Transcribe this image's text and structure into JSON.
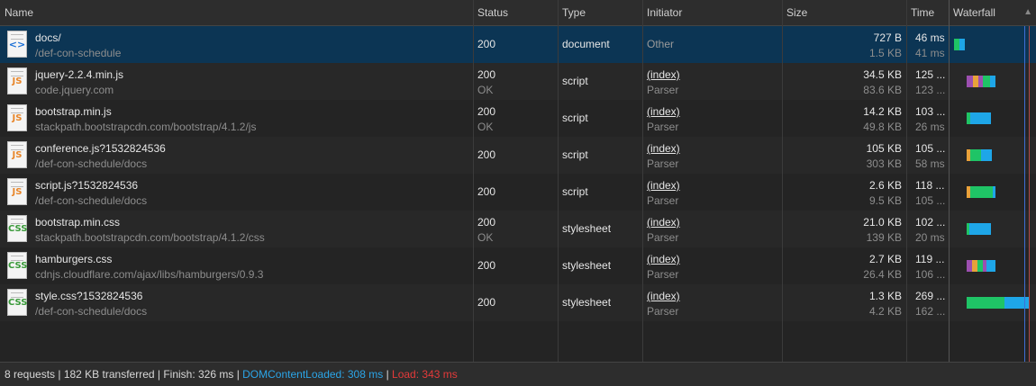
{
  "columns": {
    "name": "Name",
    "status": "Status",
    "type": "Type",
    "initiator": "Initiator",
    "size": "Size",
    "time": "Time",
    "waterfall": "Waterfall"
  },
  "sort_indicator": "▲",
  "requests": [
    {
      "icon": "doc",
      "icon_text": "<>",
      "name": "docs/",
      "path": "/def-con-schedule",
      "status": "200",
      "status_text": "",
      "type": "document",
      "initiator": "Other",
      "initiator_link": false,
      "initiator_sub": "",
      "size": "727 B",
      "resource_size": "1.5 KB",
      "time": "46 ms",
      "latency": "41 ms",
      "selected": true
    },
    {
      "icon": "js",
      "icon_text": "JS",
      "name": "jquery-2.2.4.min.js",
      "path": "code.jquery.com",
      "status": "200",
      "status_text": "OK",
      "type": "script",
      "initiator": "(index)",
      "initiator_link": true,
      "initiator_sub": "Parser",
      "size": "34.5 KB",
      "resource_size": "83.6 KB",
      "time": "125 ...",
      "latency": "123 ..."
    },
    {
      "icon": "js",
      "icon_text": "JS",
      "name": "bootstrap.min.js",
      "path": "stackpath.bootstrapcdn.com/bootstrap/4.1.2/js",
      "status": "200",
      "status_text": "OK",
      "type": "script",
      "initiator": "(index)",
      "initiator_link": true,
      "initiator_sub": "Parser",
      "size": "14.2 KB",
      "resource_size": "49.8 KB",
      "time": "103 ...",
      "latency": "26 ms"
    },
    {
      "icon": "js",
      "icon_text": "JS",
      "name": "conference.js?1532824536",
      "path": "/def-con-schedule/docs",
      "status": "200",
      "status_text": "",
      "type": "script",
      "initiator": "(index)",
      "initiator_link": true,
      "initiator_sub": "Parser",
      "size": "105 KB",
      "resource_size": "303 KB",
      "time": "105 ...",
      "latency": "58 ms"
    },
    {
      "icon": "js",
      "icon_text": "JS",
      "name": "script.js?1532824536",
      "path": "/def-con-schedule/docs",
      "status": "200",
      "status_text": "",
      "type": "script",
      "initiator": "(index)",
      "initiator_link": true,
      "initiator_sub": "Parser",
      "size": "2.6 KB",
      "resource_size": "9.5 KB",
      "time": "118 ...",
      "latency": "105 ..."
    },
    {
      "icon": "css",
      "icon_text": "CSS",
      "name": "bootstrap.min.css",
      "path": "stackpath.bootstrapcdn.com/bootstrap/4.1.2/css",
      "status": "200",
      "status_text": "OK",
      "type": "stylesheet",
      "initiator": "(index)",
      "initiator_link": true,
      "initiator_sub": "Parser",
      "size": "21.0 KB",
      "resource_size": "139 KB",
      "time": "102 ...",
      "latency": "20 ms"
    },
    {
      "icon": "css",
      "icon_text": "CSS",
      "name": "hamburgers.css",
      "path": "cdnjs.cloudflare.com/ajax/libs/hamburgers/0.9.3",
      "status": "200",
      "status_text": "",
      "type": "stylesheet",
      "initiator": "(index)",
      "initiator_link": true,
      "initiator_sub": "Parser",
      "size": "2.7 KB",
      "resource_size": "26.4 KB",
      "time": "119 ...",
      "latency": "106 ..."
    },
    {
      "icon": "css",
      "icon_text": "CSS",
      "name": "style.css?1532824536",
      "path": "/def-con-schedule/docs",
      "status": "200",
      "status_text": "",
      "type": "stylesheet",
      "initiator": "(index)",
      "initiator_link": true,
      "initiator_sub": "Parser",
      "size": "1.3 KB",
      "resource_size": "4.2 KB",
      "time": "269 ...",
      "latency": "162 ..."
    }
  ],
  "footer": {
    "summary": "8 requests | 182 KB transferred | Finish: 326 ms | ",
    "dom_content_loaded": "DOMContentLoaded: 308 ms",
    "separator": " | ",
    "load": "Load: 343 ms"
  },
  "colors": {
    "dom_content_loaded": "#2ba5e8",
    "load": "#e43a3a",
    "waiting": "#1fc466",
    "download": "#1ea6e8",
    "dns": "#9c4fb0",
    "connect": "#e8a23a"
  }
}
